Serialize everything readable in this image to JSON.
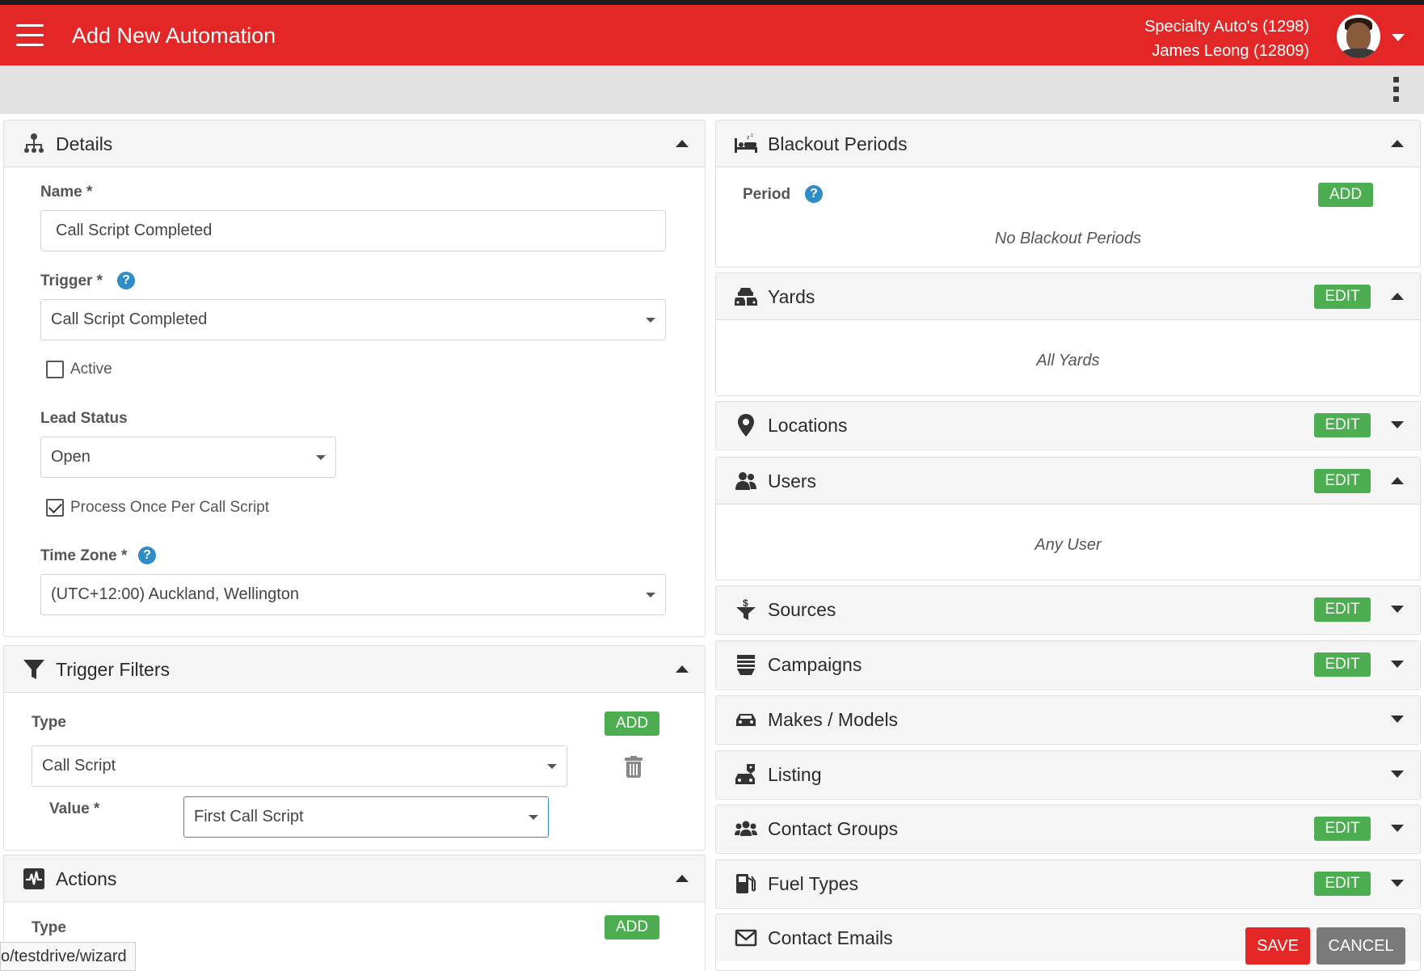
{
  "header": {
    "title": "Add New Automation",
    "account_line1": "Specialty Auto's (1298)",
    "account_line2": "James Leong (12809)"
  },
  "details": {
    "title": "Details",
    "name_label": "Name *",
    "name_value": "Call Script Completed",
    "trigger_label": "Trigger *",
    "trigger_value": "Call Script Completed",
    "active_label": "Active",
    "active_checked": false,
    "lead_status_label": "Lead Status",
    "lead_status_value": "Open",
    "process_once_label": "Process Once Per Call Script",
    "process_once_checked": true,
    "timezone_label": "Time Zone *",
    "timezone_value": "(UTC+12:00) Auckland, Wellington"
  },
  "trigger_filters": {
    "title": "Trigger Filters",
    "type_label": "Type",
    "add_label": "ADD",
    "type_value": "Call Script",
    "value_label": "Value *",
    "value_value": "First Call Script"
  },
  "actions": {
    "title": "Actions",
    "type_label": "Type",
    "add_label": "ADD"
  },
  "blackout": {
    "title": "Blackout Periods",
    "period_label": "Period",
    "add_label": "ADD",
    "empty": "No Blackout Periods"
  },
  "right_sections": {
    "edit_label": "EDIT",
    "yards_title": "Yards",
    "yards_empty": "All Yards",
    "locations_title": "Locations",
    "users_title": "Users",
    "users_empty": "Any User",
    "sources_title": "Sources",
    "campaigns_title": "Campaigns",
    "makes_title": "Makes / Models",
    "listing_title": "Listing",
    "contact_groups_title": "Contact Groups",
    "fuel_types_title": "Fuel Types",
    "contact_emails_title": "Contact Emails"
  },
  "footer": {
    "save_label": "SAVE",
    "cancel_label": "CANCEL",
    "status_url": "o/testdrive/wizard"
  },
  "colors": {
    "brand_red": "#e32726",
    "green": "#4cae50",
    "help_blue": "#2e8cc7"
  },
  "help_glyph": "?"
}
